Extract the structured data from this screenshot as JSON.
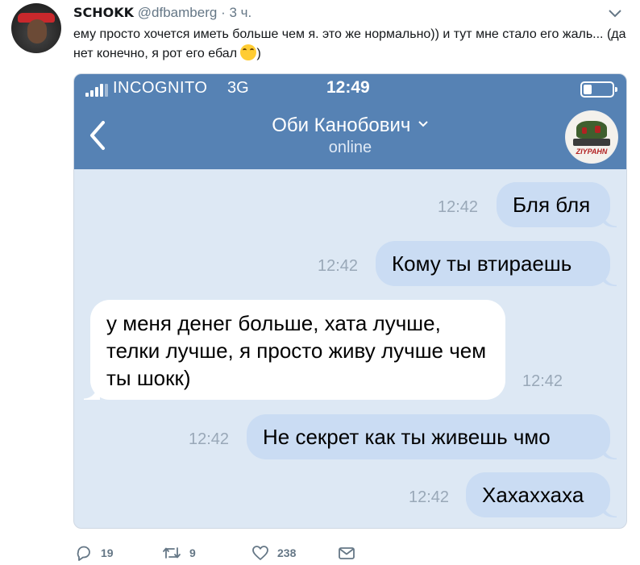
{
  "tweet": {
    "display_name": "SCHOKK",
    "handle": "@dfbamberg",
    "separator": "·",
    "time": "3 ч.",
    "text": "ему просто хочется иметь больше чем я. это же нормально)) и тут мне стало его жаль... (да нет конечно, я рот его ебал",
    "text_end": ")",
    "emoji_icon": "face-with-tears-of-joy-icon"
  },
  "screenshot": {
    "status": {
      "carrier": "INCOGNITO",
      "network": "3G",
      "time": "12:49"
    },
    "contact": {
      "name": "Оби Канобович",
      "status": "online",
      "avatar_caption": "ZIYPAHN"
    },
    "messages": [
      {
        "direction": "out",
        "text": "Бля бля",
        "time": "12:42"
      },
      {
        "direction": "out",
        "text": "Кому ты втираешь",
        "time": "12:42"
      },
      {
        "direction": "in",
        "text": "у меня денег больше, хата лучше, телки лучше, я просто живу лучше чем ты шокк)",
        "time": "12:42"
      },
      {
        "direction": "out",
        "text": "Не секрет как ты живешь чмо",
        "time": "12:42"
      },
      {
        "direction": "out",
        "text": "Хахаххаха",
        "time": "12:42"
      }
    ]
  },
  "actions": {
    "reply_count": "19",
    "retweet_count": "9",
    "like_count": "238"
  },
  "colors": {
    "telegram_header": "#5682b4",
    "chat_background": "#dde8f4",
    "outgoing_bubble": "#cadcf3",
    "incoming_bubble": "#ffffff",
    "twitter_gray": "#657786"
  }
}
